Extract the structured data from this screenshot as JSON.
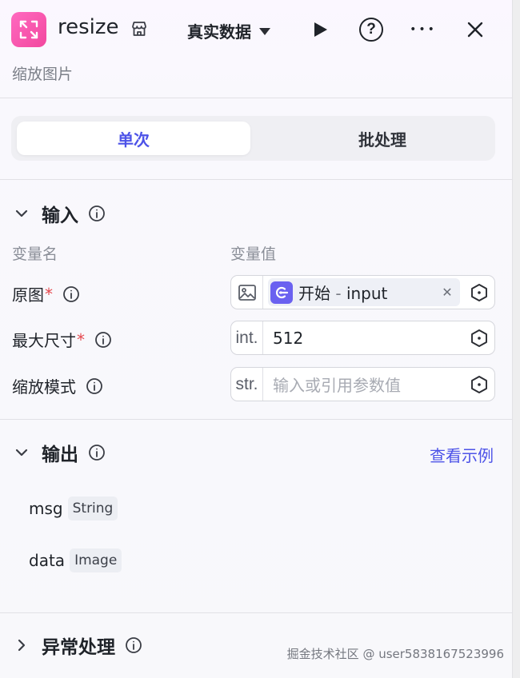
{
  "header": {
    "node_title": "resize",
    "mode_label": "真实数据",
    "subtitle": "缩放图片",
    "help_glyph": "?",
    "more_glyph": "•••"
  },
  "tabs": [
    {
      "label": "单次",
      "active": true
    },
    {
      "label": "批处理",
      "active": false
    }
  ],
  "input": {
    "title": "输入",
    "col_name": "变量名",
    "col_value": "变量值",
    "params": [
      {
        "label": "原图",
        "required": "*",
        "type": "",
        "ref_source": "开始",
        "ref_sep": " - ",
        "ref_field": "input"
      },
      {
        "label": "最大尺寸",
        "required": "*",
        "type": "int.",
        "value": "512"
      },
      {
        "label": "缩放模式",
        "required": "",
        "type": "str.",
        "placeholder": "输入或引用参数值"
      }
    ]
  },
  "output": {
    "title": "输出",
    "example_link": "查看示例",
    "fields": [
      {
        "name": "msg",
        "type": "String"
      },
      {
        "name": "data",
        "type": "Image"
      }
    ]
  },
  "exception": {
    "title": "异常处理"
  },
  "watermark": "掘金技术社区 @ user5838167523996",
  "colors": {
    "accent": "#4d53e8",
    "node_icon": "#f2479e",
    "ref_icon": "#6a61f0",
    "required": "#e5484d"
  }
}
